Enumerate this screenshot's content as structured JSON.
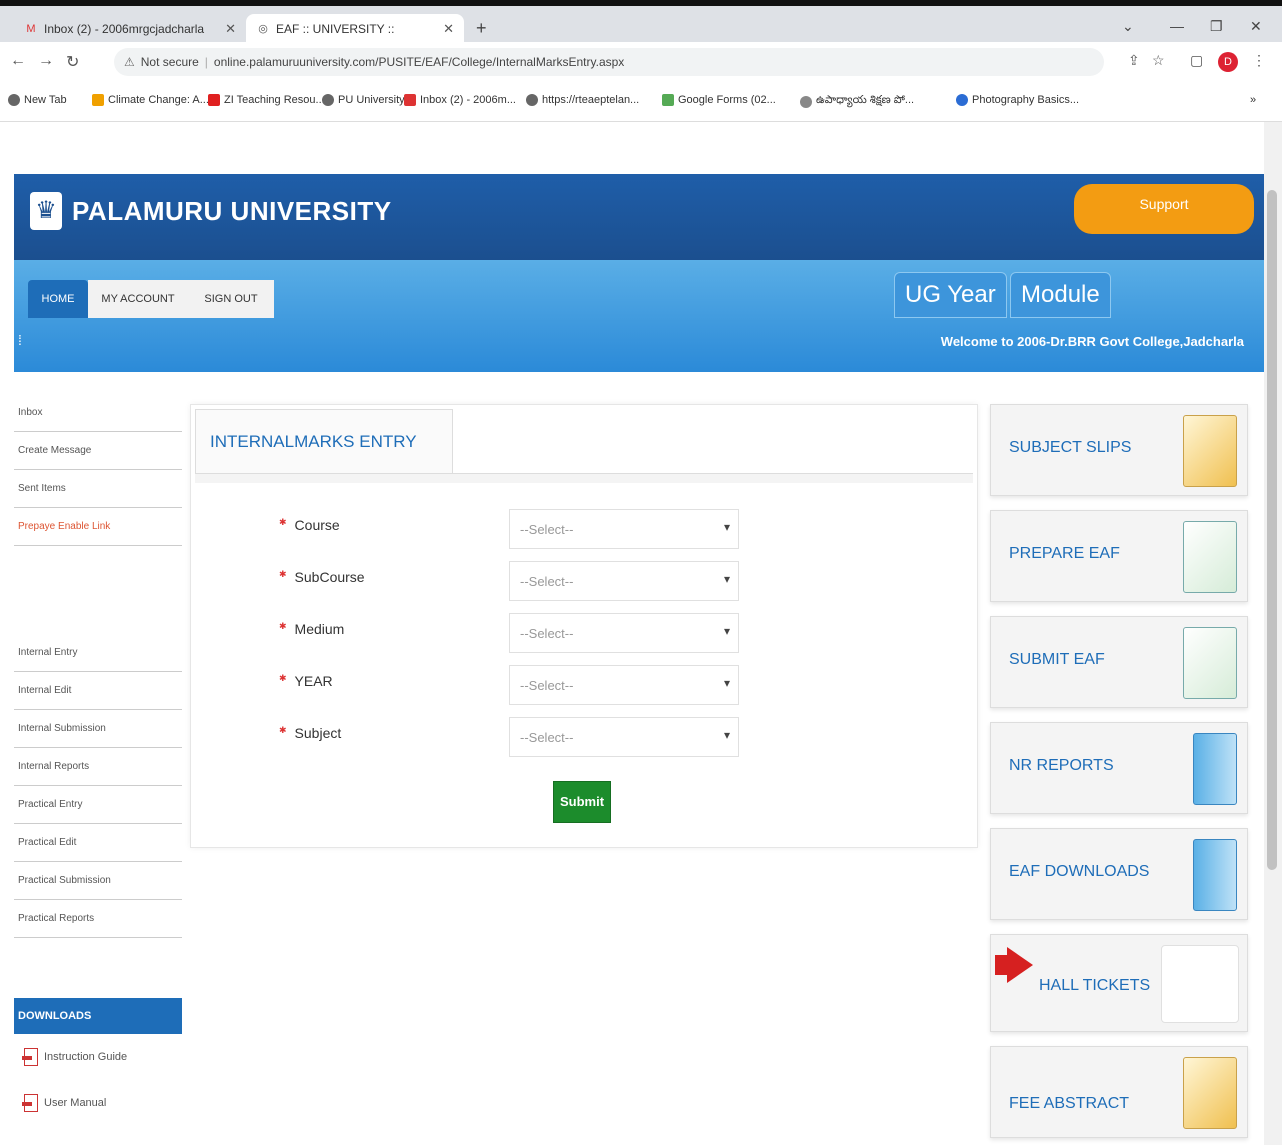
{
  "browser": {
    "tabs": [
      {
        "title": "Inbox (2) - 2006mrgcjadcharla",
        "favicon": "gmail-icon"
      },
      {
        "title": "EAF :: UNIVERSITY ::",
        "favicon": "globe-icon"
      }
    ],
    "url_security": "Not secure",
    "url": "online.palamuruuniversity.com/PUSITE/EAF/College/InternalMarksEntry.aspx",
    "bookmarks": [
      {
        "label": "New Tab",
        "color": "#666"
      },
      {
        "label": "Climate Change: A...",
        "color": "#f0a000"
      },
      {
        "label": "ZI Teaching Resou...",
        "color": "#e02020"
      },
      {
        "label": "PU University",
        "color": "#666"
      },
      {
        "label": "Inbox (2) - 2006m...",
        "color": "#d33"
      },
      {
        "label": "https://rteaeptelan...",
        "color": "#666"
      },
      {
        "label": "Google Forms (02...",
        "color": "#5a5"
      },
      {
        "label": "ఉపాధ్యాయ శిక్షణ పో...",
        "color": "#888"
      },
      {
        "label": "Photography Basics...",
        "color": "#2b6cd4"
      }
    ],
    "profile_initial": "D"
  },
  "header": {
    "title": "PALAMURU UNIVERSITY",
    "support": "Support"
  },
  "nav": {
    "home": "HOME",
    "my_account": "MY ACCOUNT",
    "sign_out": "SIGN OUT",
    "ug_year": "UG Year",
    "module": "Module",
    "welcome": "Welcome to 2006-Dr.BRR Govt College,Jadcharla"
  },
  "sidebar": {
    "group1": [
      "Inbox",
      "Create Message",
      "Sent Items",
      "Prepaye Enable Link"
    ],
    "group2": [
      "Internal Entry",
      "Internal Edit",
      "Internal Submission",
      "Internal Reports",
      "Practical Entry",
      "Practical Edit",
      "Practical Submission",
      "Practical Reports"
    ],
    "downloads_heading": "DOWNLOADS",
    "downloads": [
      "Instruction Guide",
      "User Manual"
    ]
  },
  "form": {
    "heading": "INTERNALMARKS ENTRY",
    "fields": [
      {
        "label": "Course",
        "value": "--Select--"
      },
      {
        "label": "SubCourse",
        "value": "--Select--"
      },
      {
        "label": "Medium",
        "value": "--Select--"
      },
      {
        "label": "YEAR",
        "value": "--Select--"
      },
      {
        "label": "Subject",
        "value": "--Select--"
      }
    ],
    "submit": "Submit"
  },
  "right_panel": [
    "SUBJECT SLIPS",
    "PREPARE EAF",
    "SUBMIT EAF",
    "NR REPORTS",
    "EAF DOWNLOADS",
    "HALL TICKETS",
    "FEE ABSTRACT"
  ]
}
